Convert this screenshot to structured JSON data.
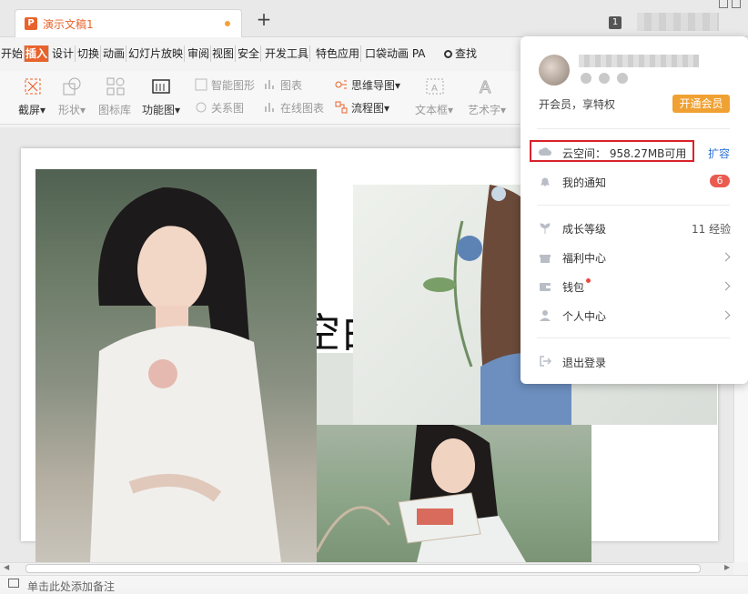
{
  "tab": {
    "title": "演示文稿1",
    "new_tab": "+",
    "window_count": "1"
  },
  "menu": {
    "items": [
      "开始",
      "插入",
      "设计",
      "切换",
      "动画",
      "幻灯片放映",
      "审阅",
      "视图",
      "安全",
      "开发工具",
      "特色应用",
      "口袋动画 PA"
    ],
    "active": "插入",
    "search": "查找"
  },
  "ribbon": {
    "screenshot": "截屏",
    "shape": "形状",
    "icon_lib": "图标库",
    "function_chart": "功能图",
    "smart_shape": "智能图形",
    "chart": "图表",
    "relation_chart": "关系图",
    "online_chart": "在线图表",
    "mind_map": "思维导图",
    "flow_chart": "流程图",
    "text_box": "文本框",
    "art_text": "艺术字"
  },
  "slide": {
    "big_text": "空白"
  },
  "notes": {
    "placeholder": "单击此处添加备注"
  },
  "popup": {
    "vip_text": "开会员，享特权",
    "vip_button": "开通会员",
    "cloud_label": "云空间：",
    "cloud_value": "958.27MB可用",
    "expand": "扩容",
    "notifications": "我的通知",
    "notifications_count": "6",
    "growth": "成长等级",
    "growth_value": "11 经验",
    "welfare": "福利中心",
    "wallet": "钱包",
    "personal": "个人中心",
    "logout": "退出登录"
  },
  "colors": {
    "accent": "#e8632b",
    "vip": "#f0a133",
    "link": "#2f73d6",
    "highlight": "#d9222a"
  }
}
